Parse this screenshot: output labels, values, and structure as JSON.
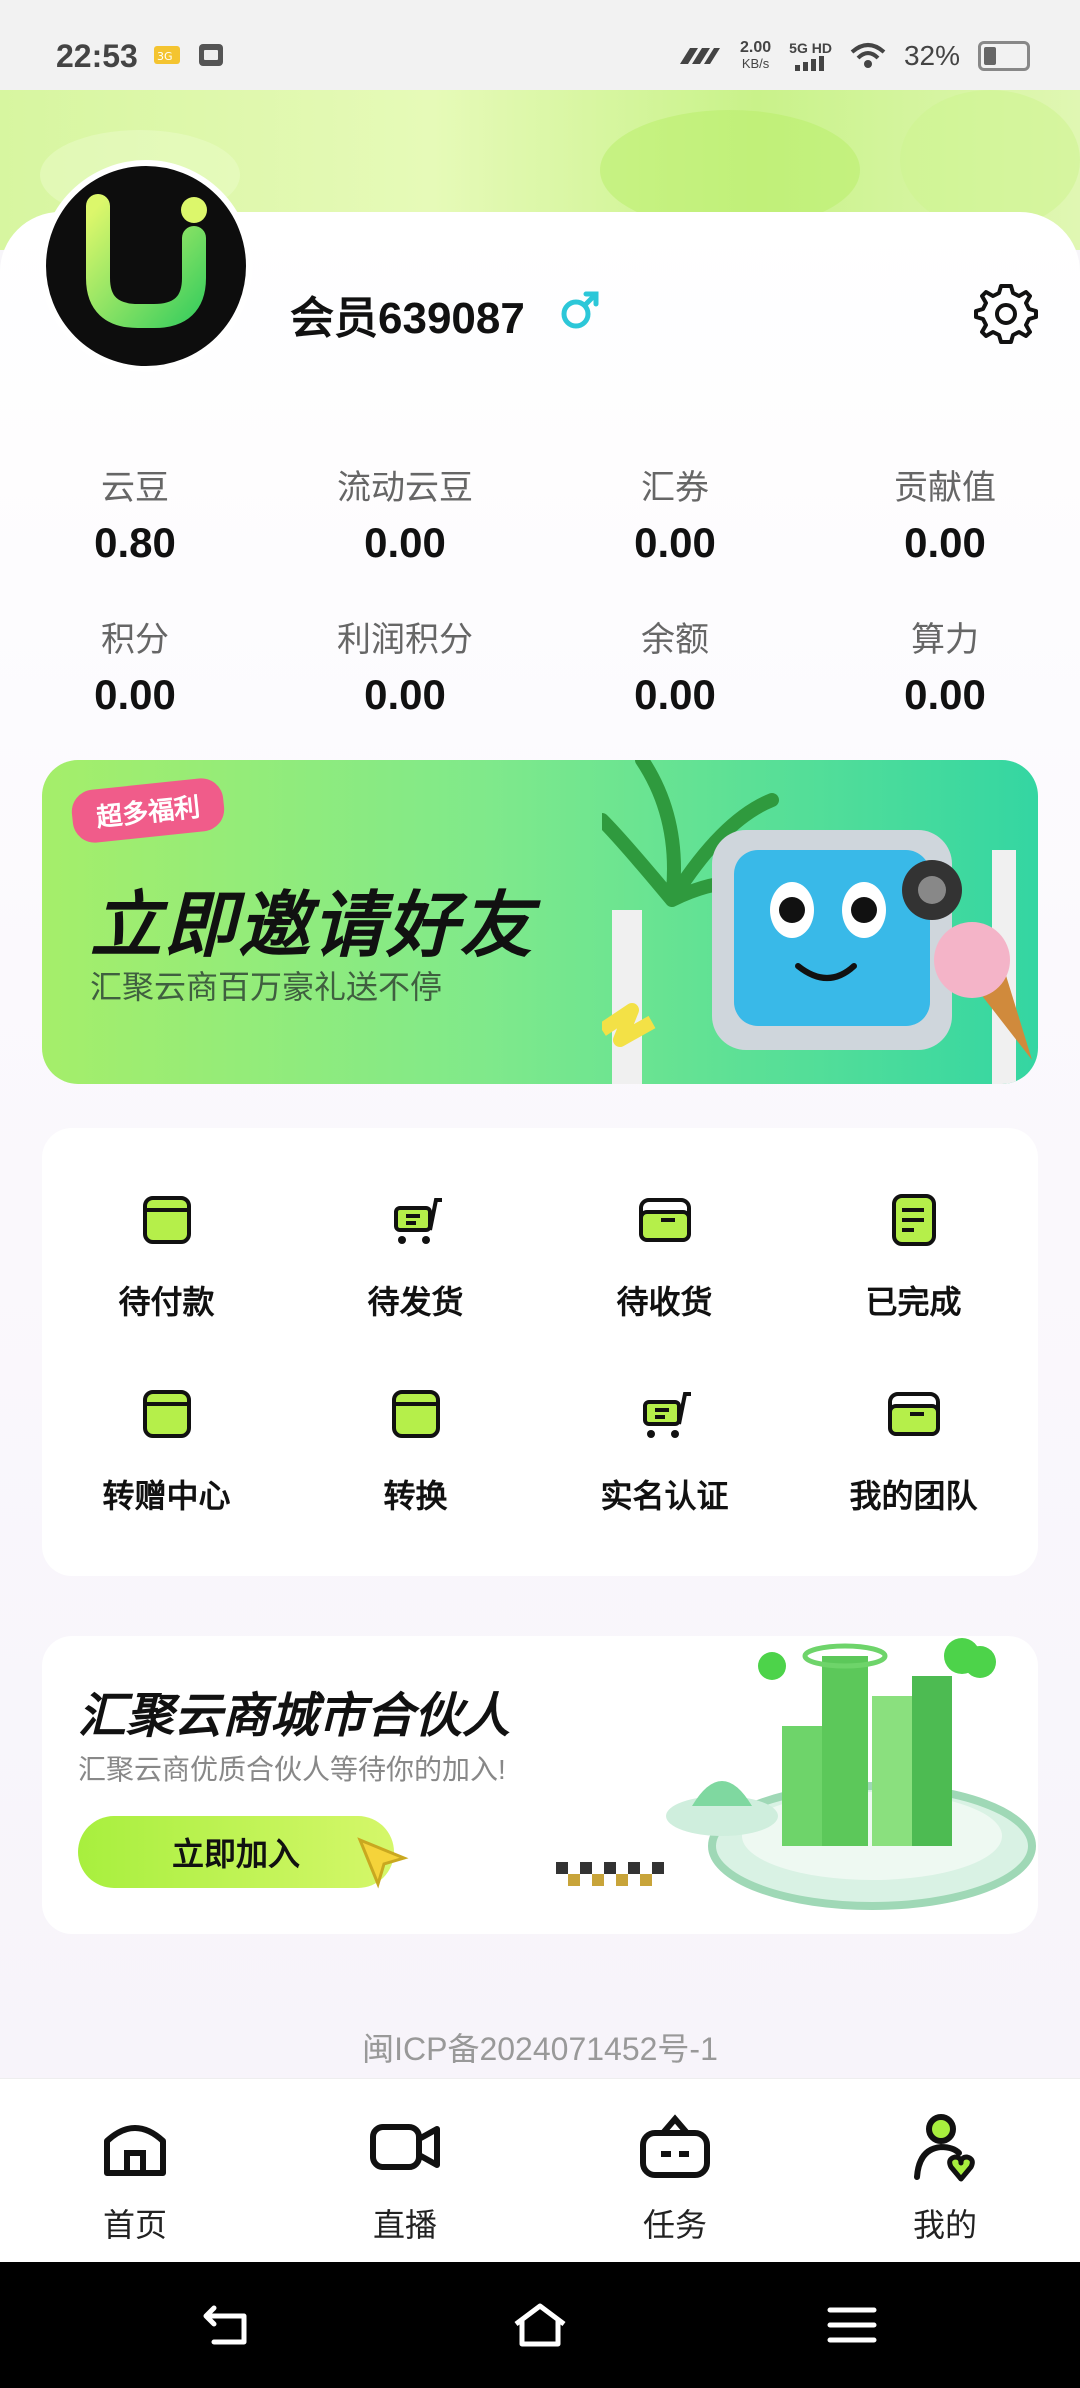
{
  "status_bar": {
    "time": "22:53",
    "speed": "2.00",
    "speed_unit": "KB/s",
    "network": "5G HD",
    "battery": "32%"
  },
  "profile": {
    "username": "会员639087"
  },
  "stats": [
    {
      "label": "云豆",
      "value": "0.80"
    },
    {
      "label": "流动云豆",
      "value": "0.00"
    },
    {
      "label": "汇券",
      "value": "0.00"
    },
    {
      "label": "贡献值",
      "value": "0.00"
    },
    {
      "label": "积分",
      "value": "0.00"
    },
    {
      "label": "利润积分",
      "value": "0.00"
    },
    {
      "label": "余额",
      "value": "0.00"
    },
    {
      "label": "算力",
      "value": "0.00"
    }
  ],
  "invite_banner": {
    "tag": "超多福利",
    "title": "立即邀请好友",
    "subtitle": "汇聚云商百万豪礼送不停"
  },
  "menu": [
    {
      "label": "待付款",
      "icon": "wallet-icon"
    },
    {
      "label": "待发货",
      "icon": "cart-icon"
    },
    {
      "label": "待收货",
      "icon": "box-icon"
    },
    {
      "label": "已完成",
      "icon": "document-icon"
    },
    {
      "label": "转赠中心",
      "icon": "wallet-icon"
    },
    {
      "label": "转换",
      "icon": "wallet-icon"
    },
    {
      "label": "实名认证",
      "icon": "cart-icon"
    },
    {
      "label": "我的团队",
      "icon": "box-icon"
    }
  ],
  "partner_card": {
    "title": "汇聚云商城市合伙人",
    "subtitle": "汇聚云商优质合伙人等待你的加入!",
    "button": "立即加入"
  },
  "footer": {
    "icp": "闽ICP备2024071452号-1"
  },
  "tabbar": [
    {
      "label": "首页",
      "icon": "home-icon"
    },
    {
      "label": "直播",
      "icon": "video-icon"
    },
    {
      "label": "任务",
      "icon": "task-icon"
    },
    {
      "label": "我的",
      "icon": "profile-icon"
    }
  ],
  "colors": {
    "accent_green": "#a8ef3e",
    "brand_dark": "#0d0d0d",
    "gender_blue": "#2cc7d8"
  }
}
